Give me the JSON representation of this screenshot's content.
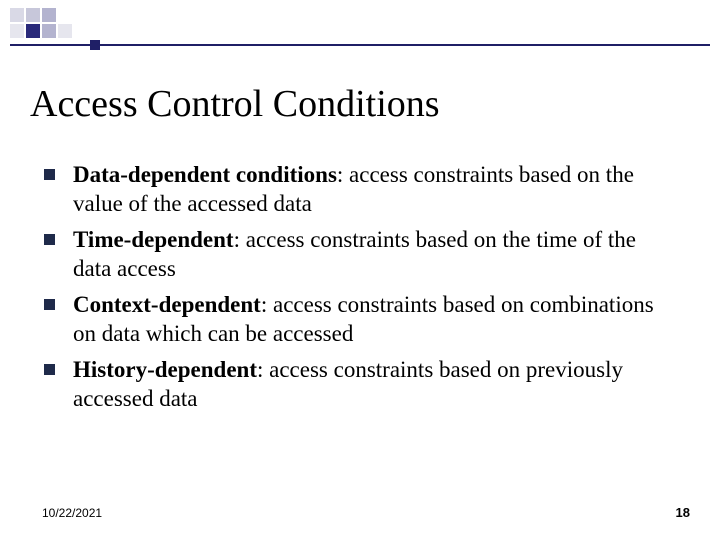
{
  "title": "Access Control Conditions",
  "bullets": [
    {
      "lead": "Data-dependent conditions",
      "rest": ": access constraints based on the value of the accessed data"
    },
    {
      "lead": "Time-dependent",
      "rest": ": access constraints based on the time of the data access"
    },
    {
      "lead": "Context-dependent",
      "rest": ": access constraints based on combinations on data which can be accessed"
    },
    {
      "lead": "History-dependent",
      "rest": ": access constraints based on previously accessed data"
    }
  ],
  "footer": {
    "date": "10/22/2021",
    "page": "18"
  },
  "colors": {
    "accent_dark_blue": "#1f1f66",
    "bullet_navy": "#1f2a4a"
  }
}
